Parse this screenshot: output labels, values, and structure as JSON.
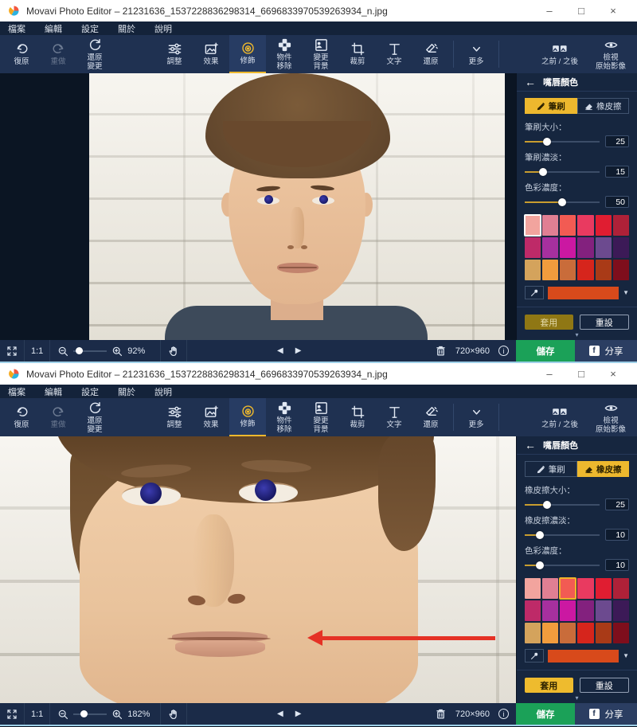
{
  "window1": {
    "title": "Movavi Photo Editor – 21231636_1537228836298314_6696833970539263934_n.jpg",
    "window_controls": {
      "minimize": "–",
      "maximize": "□",
      "close": "×"
    },
    "menu": [
      "檔案",
      "編輯",
      "設定",
      "關於",
      "說明"
    ],
    "toolbar": {
      "undo": "復原",
      "redo": "重做",
      "revert": "還原\n變更",
      "adjust": "調整",
      "effects": "效果",
      "retouch": "修飾",
      "object_removal": "物件\n移除",
      "change_background": "變更\n背景",
      "crop": "裁剪",
      "text": "文字",
      "restore": "還原",
      "more": "更多",
      "before_after": "之前 / 之後",
      "view_original": "檢視\n原始影像"
    },
    "photo": "portrait",
    "panel": {
      "header": "嘴唇顏色",
      "tabs": {
        "brush": "筆刷",
        "eraser": "橡皮擦",
        "active": "brush"
      },
      "sliders": [
        {
          "label": "筆刷大小：",
          "value": "25",
          "pct": 30
        },
        {
          "label": "筆刷濃淡：",
          "value": "15",
          "pct": 24
        },
        {
          "label": "色彩濃度：",
          "value": "50",
          "pct": 50
        }
      ],
      "swatches": [
        "#f2a49e",
        "#e07f93",
        "#f25b53",
        "#e93a60",
        "#e01d31",
        "#ae2138",
        "#be2a68",
        "#a6309e",
        "#cb18a2",
        "#83217e",
        "#6c4a8f",
        "#3c1a57",
        "#d4a35c",
        "#f19c3d",
        "#c96c3a",
        "#d6251c",
        "#a93a17",
        "#7e0e1c"
      ],
      "selected_swatch": 0,
      "selected_border": "#ffffff",
      "current_color": "#d84a1b",
      "apply": "套用",
      "reset": "重設",
      "apply_style": "dim",
      "scroll_hint": "▾"
    },
    "statusbar": {
      "actual_size": "1:1",
      "zoom": "92%",
      "zoom_pct": 18,
      "dimensions": "720×960",
      "prev": "◀",
      "next": "▶"
    },
    "footer": {
      "save": "儲存",
      "share": "分享",
      "facebook": "f"
    }
  },
  "window2": {
    "title": "Movavi Photo Editor – 21231636_1537228836298314_6696833970539263934_n.jpg",
    "window_controls": {
      "minimize": "–",
      "maximize": "□",
      "close": "×"
    },
    "menu": [
      "檔案",
      "編輯",
      "設定",
      "關於",
      "說明"
    ],
    "toolbar": {
      "undo": "復原",
      "redo": "重做",
      "revert": "還原\n變更",
      "adjust": "調整",
      "effects": "效果",
      "retouch": "修飾",
      "object_removal": "物件\n移除",
      "change_background": "變更\n背景",
      "crop": "裁剪",
      "text": "文字",
      "restore": "還原",
      "more": "更多",
      "before_after": "之前 / 之後",
      "view_original": "檢視\n原始影像"
    },
    "photo": "closeup",
    "panel": {
      "header": "嘴唇顏色",
      "tabs": {
        "brush": "筆刷",
        "eraser": "橡皮擦",
        "active": "eraser"
      },
      "sliders": [
        {
          "label": "橡皮擦大小：",
          "value": "25",
          "pct": 30
        },
        {
          "label": "橡皮擦濃淡：",
          "value": "10",
          "pct": 20
        },
        {
          "label": "色彩濃度：",
          "value": "10",
          "pct": 20
        }
      ],
      "swatches": [
        "#f2a49e",
        "#e07f93",
        "#f25b53",
        "#e93a60",
        "#e01d31",
        "#ae2138",
        "#be2a68",
        "#a6309e",
        "#cb18a2",
        "#83217e",
        "#6c4a8f",
        "#3c1a57",
        "#d4a35c",
        "#f19c3d",
        "#c96c3a",
        "#d6251c",
        "#a93a17",
        "#7e0e1c"
      ],
      "selected_swatch": 2,
      "selected_border": "#f0b429",
      "current_color": "#d84a1b",
      "apply": "套用",
      "reset": "重設",
      "apply_style": "bright",
      "scroll_hint": "▾"
    },
    "statusbar": {
      "actual_size": "1:1",
      "zoom": "182%",
      "zoom_pct": 32,
      "dimensions": "720×960",
      "prev": "◀",
      "next": "▶"
    },
    "footer": {
      "save": "儲存",
      "share": "分享",
      "facebook": "f"
    }
  }
}
